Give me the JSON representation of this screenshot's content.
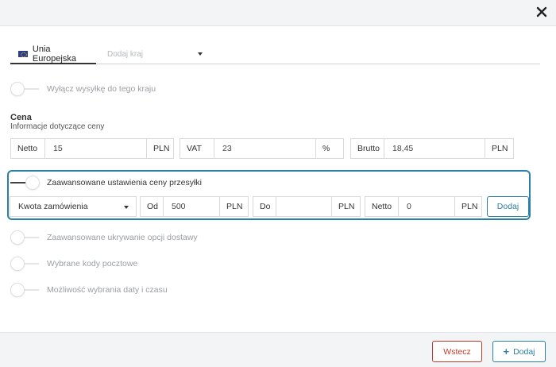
{
  "header": {
    "close_icon": "close-icon"
  },
  "tabs": {
    "active_label": "Unia Europejska",
    "add_country_placeholder": "Dodaj kraj"
  },
  "toggles": {
    "disable_shipping": "Wyłącz wysyłkę do tego kraju",
    "advanced_price": "Zaawansowane ustawienia ceny przesyłki",
    "advanced_hiding": "Zaawansowane ukrywanie opcji dostawy",
    "postal_codes": "Wybrane kody pocztowe",
    "date_time": "Możliwość wybrania daty i czasu"
  },
  "price": {
    "title": "Cena",
    "subtitle": "Informacje dotyczące ceny",
    "netto_label": "Netto",
    "netto_value": "15",
    "netto_unit": "PLN",
    "vat_label": "VAT",
    "vat_value": "23",
    "vat_unit": "%",
    "brutto_label": "Brutto",
    "brutto_value": "18,45",
    "brutto_unit": "PLN"
  },
  "advanced": {
    "select_value": "Kwota zamówienia",
    "from_label": "Od",
    "from_value": "500",
    "from_unit": "PLN",
    "to_label": "Do",
    "to_value": "",
    "to_unit": "PLN",
    "netto_label": "Netto",
    "netto_value": "0",
    "netto_unit": "PLN",
    "add_button": "Dodaj"
  },
  "footer": {
    "back_button": "Wstecz",
    "add_button": "Dodaj"
  },
  "colors": {
    "accent": "#2a7fa6",
    "danger": "#c0392b"
  }
}
